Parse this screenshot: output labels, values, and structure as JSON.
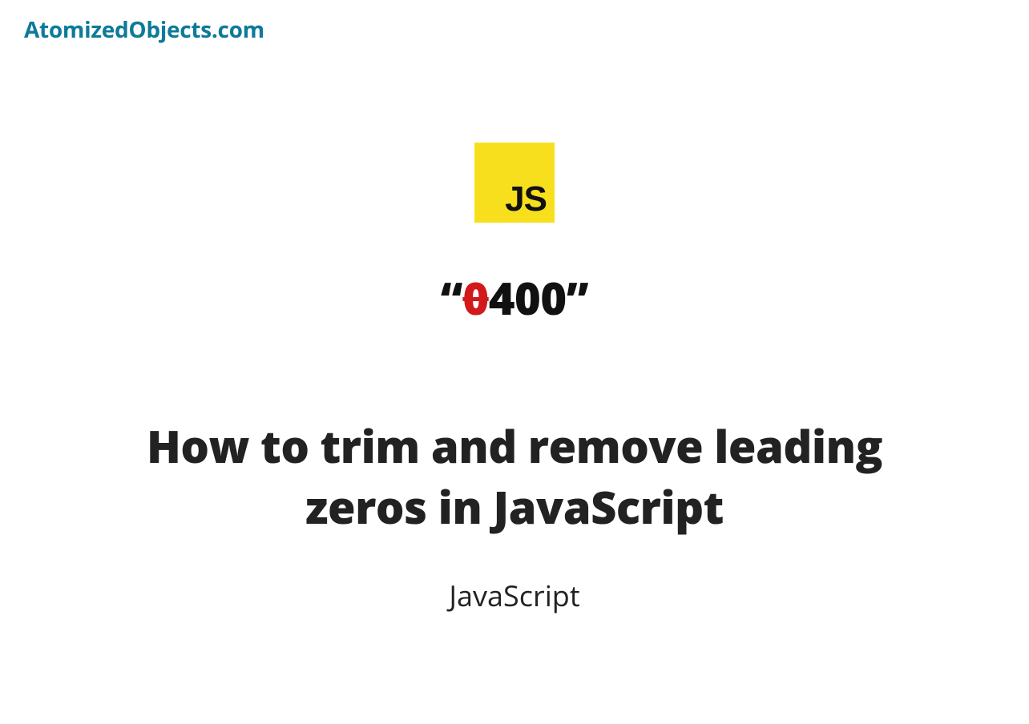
{
  "site": {
    "name": "AtomizedObjects.com"
  },
  "logo": {
    "text": "JS"
  },
  "example": {
    "quote_open": "“",
    "struck": "0",
    "rest": "400",
    "quote_close": "”"
  },
  "article": {
    "title": "How to trim and remove leading zeros in JavaScript",
    "category": "JavaScript"
  }
}
